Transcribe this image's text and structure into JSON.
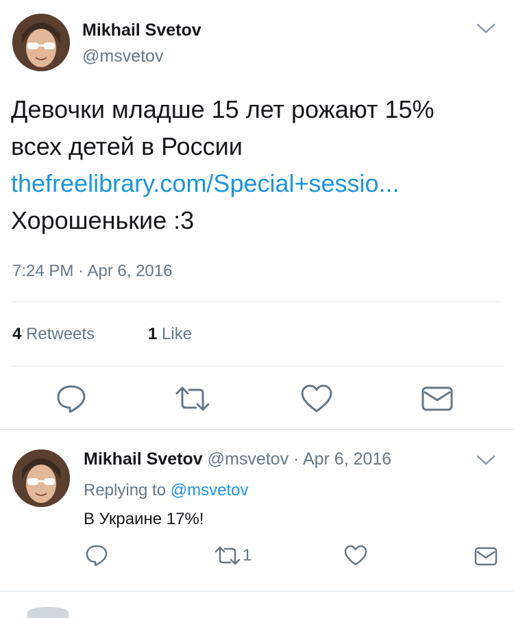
{
  "main_tweet": {
    "author_name": "Mikhail Svetov",
    "author_handle": "@msvetov",
    "text_line1": "Девочки младше 15 лет рожают 15%",
    "text_line2": "всех детей в России",
    "link": "thefreelibrary.com/Special+sessio...",
    "text_line4": "Хорошенькие :3",
    "timestamp": "7:24 PM · Apr 6, 2016",
    "retweets_count": "4",
    "retweets_label": "Retweets",
    "likes_count": "1",
    "likes_label": "Like"
  },
  "reply": {
    "author_name": "Mikhail Svetov",
    "author_handle": "@msvetov",
    "separator": "·",
    "date": "Apr 6, 2016",
    "replying_prefix": "Replying to",
    "replying_handle": "@msvetov",
    "text": "В Украине 17%!",
    "retweet_count": "1"
  },
  "colors": {
    "link": "#1b95e0",
    "secondary_text": "#657786",
    "divider": "#e6ecf0",
    "icon": "#657786"
  }
}
